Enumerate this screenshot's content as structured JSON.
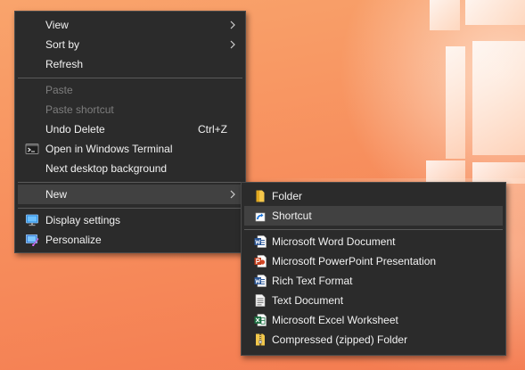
{
  "desktop_menu": {
    "items": [
      {
        "label": "View"
      },
      {
        "label": "Sort by"
      },
      {
        "label": "Refresh"
      },
      {
        "label": "Paste"
      },
      {
        "label": "Paste shortcut"
      },
      {
        "label": "Undo Delete",
        "shortcut": "Ctrl+Z"
      },
      {
        "label": "Open in Windows Terminal",
        "icon": "terminal-icon"
      },
      {
        "label": "Next desktop background"
      },
      {
        "label": "New"
      },
      {
        "label": "Display settings",
        "icon": "display-icon"
      },
      {
        "label": "Personalize",
        "icon": "personalize-icon"
      }
    ]
  },
  "new_submenu": {
    "items": [
      {
        "label": "Folder",
        "icon": "folder-icon"
      },
      {
        "label": "Shortcut",
        "icon": "shortcut-icon"
      },
      {
        "label": "Microsoft Word Document",
        "icon": "word-icon"
      },
      {
        "label": "Microsoft PowerPoint Presentation",
        "icon": "powerpoint-icon"
      },
      {
        "label": "Rich Text Format",
        "icon": "rtf-icon"
      },
      {
        "label": "Text Document",
        "icon": "text-document-icon"
      },
      {
        "label": "Microsoft Excel Worksheet",
        "icon": "excel-icon"
      },
      {
        "label": "Compressed (zipped) Folder",
        "icon": "zip-folder-icon"
      }
    ]
  },
  "colors": {
    "menu_background": "#2b2b2b",
    "menu_highlight": "#414141",
    "menu_text": "#f2f2f2",
    "menu_disabled_text": "#7d7d7d",
    "desktop_wallpaper": "#f7905e"
  }
}
